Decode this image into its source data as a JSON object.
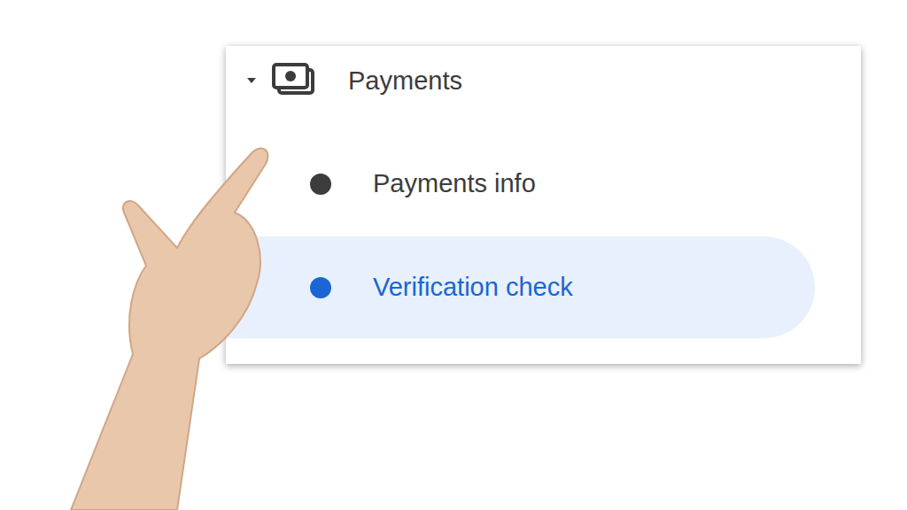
{
  "menu": {
    "section": {
      "label": "Payments",
      "expanded": true
    },
    "items": [
      {
        "label": "Payments info",
        "selected": false
      },
      {
        "label": "Verification check",
        "selected": true
      }
    ]
  }
}
